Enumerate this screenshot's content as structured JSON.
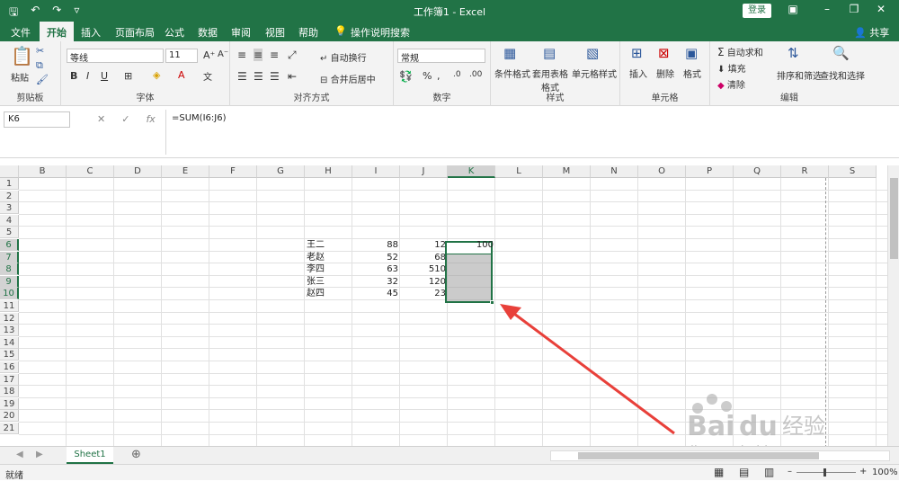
{
  "titlebar": {
    "title": "工作簿1 - Excel",
    "login": "登录"
  },
  "tabs": [
    "文件",
    "开始",
    "插入",
    "页面布局",
    "公式",
    "数据",
    "审阅",
    "视图",
    "帮助",
    "操作说明搜索"
  ],
  "share": "共享",
  "ribbon": {
    "clipboard": {
      "label": "剪贴板",
      "paste": "粘贴"
    },
    "font": {
      "label": "字体",
      "name": "等线",
      "size": "11",
      "bold": "B",
      "italic": "I",
      "underline": "U"
    },
    "align": {
      "label": "对齐方式",
      "wrap": "自动换行",
      "merge": "合并后居中"
    },
    "number": {
      "label": "数字",
      "format": "常规",
      "percent": "%"
    },
    "styles": {
      "label": "样式",
      "cond": "条件格式",
      "table": "套用表格格式",
      "cell": "单元格样式"
    },
    "cells": {
      "label": "单元格",
      "insert": "插入",
      "delete": "删除",
      "format": "格式"
    },
    "editing": {
      "label": "编辑",
      "autosum": "自动求和",
      "fill": "填充",
      "clear": "清除",
      "sort": "排序和筛选",
      "find": "查找和选择"
    }
  },
  "formula": {
    "namebox": "K6",
    "content": "=SUM(I6:J6)",
    "fx": "fx"
  },
  "columns": [
    "B",
    "C",
    "D",
    "E",
    "F",
    "G",
    "H",
    "I",
    "J",
    "K",
    "L",
    "M",
    "N",
    "O",
    "P",
    "Q",
    "R",
    "S"
  ],
  "rows": [
    "1",
    "2",
    "3",
    "4",
    "5",
    "6",
    "7",
    "8",
    "9",
    "10",
    "11",
    "12",
    "13",
    "14",
    "15",
    "16",
    "17",
    "18",
    "19",
    "20",
    "21"
  ],
  "data": [
    {
      "name": "王二",
      "i": "88",
      "j": "12",
      "k": "100"
    },
    {
      "name": "老赵",
      "i": "52",
      "j": "68",
      "k": ""
    },
    {
      "name": "李四",
      "i": "63",
      "j": "510",
      "k": ""
    },
    {
      "name": "张三",
      "i": "32",
      "j": "120",
      "k": ""
    },
    {
      "name": "赵四",
      "i": "45",
      "j": "23",
      "k": ""
    }
  ],
  "sheet": {
    "name": "Sheet1"
  },
  "status": {
    "ready": "就绪",
    "zoom": "100%"
  },
  "colors": {
    "accent": "#217346",
    "arrow": "#e8403a"
  }
}
